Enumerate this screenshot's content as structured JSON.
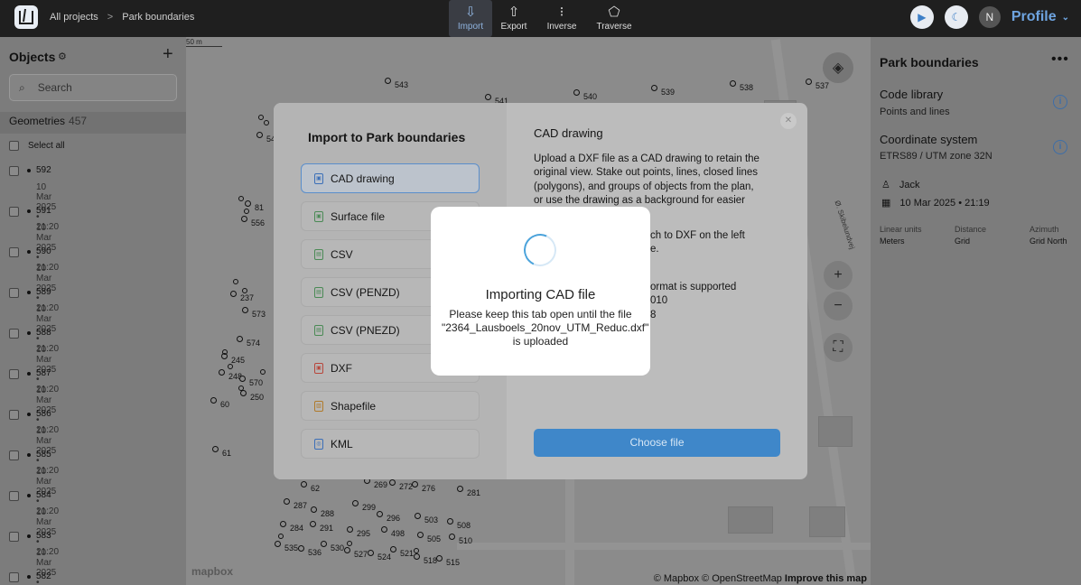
{
  "topbar": {
    "breadcrumb": [
      "All projects",
      "Park boundaries"
    ],
    "breadcrumb_separator": ">",
    "tools": [
      {
        "label": "Import",
        "icon": "import-icon",
        "active": true
      },
      {
        "label": "Export",
        "icon": "export-icon",
        "active": false
      },
      {
        "label": "Inverse",
        "icon": "inverse-icon",
        "active": false
      },
      {
        "label": "Traverse",
        "icon": "traverse-icon",
        "active": false
      }
    ],
    "avatar_initial": "N",
    "profile_label": "Profile"
  },
  "sidebar": {
    "title": "Objects",
    "search_placeholder": "Search",
    "geometries_label": "Geometries",
    "geometries_count": "457",
    "select_all": "Select all",
    "items": [
      {
        "id": "592",
        "date": "10 Mar 2025 • 21:20"
      },
      {
        "id": "591",
        "date": "10 Mar 2025 • 21:20"
      },
      {
        "id": "590",
        "date": "10 Mar 2025 • 21:20"
      },
      {
        "id": "589",
        "date": "10 Mar 2025 • 21:20"
      },
      {
        "id": "588",
        "date": "10 Mar 2025 • 21:20"
      },
      {
        "id": "587",
        "date": "10 Mar 2025 • 21:20"
      },
      {
        "id": "586",
        "date": "10 Mar 2025 • 21:20"
      },
      {
        "id": "585",
        "date": "10 Mar 2025 • 21:20"
      },
      {
        "id": "584",
        "date": "10 Mar 2025 • 21:20"
      },
      {
        "id": "583",
        "date": "10 Mar 2025 • 21:20"
      },
      {
        "id": "582",
        "date": ""
      }
    ]
  },
  "map": {
    "scale_label": "50 m",
    "street_label": "Ø. Skibelundvej",
    "attribution": "© Mapbox © OpenStreetMap",
    "improve": "Improve this map",
    "logo": "mapbox",
    "points": [
      "543",
      "541",
      "540",
      "539",
      "538",
      "537",
      "54",
      "81",
      "556",
      "237",
      "573",
      "574",
      "245",
      "248",
      "570",
      "250",
      "60",
      "61",
      "62",
      "269",
      "272",
      "276",
      "281",
      "287",
      "299",
      "288",
      "296",
      "503",
      "284",
      "291",
      "508",
      "295",
      "498",
      "505",
      "510",
      "535",
      "536",
      "530",
      "527",
      "524",
      "521",
      "518",
      "515"
    ]
  },
  "right_panel": {
    "title": "Park boundaries",
    "code_library_label": "Code library",
    "code_library_value": "Points and lines",
    "coord_system_label": "Coordinate system",
    "coord_system_value": "ETRS89 / UTM zone 32N",
    "user": "Jack",
    "created": "10 Mar 2025 • 21:19",
    "units": [
      {
        "label": "Linear units",
        "value": "Meters"
      },
      {
        "label": "Distance",
        "value": "Grid"
      },
      {
        "label": "Azimuth",
        "value": "Grid North"
      }
    ]
  },
  "dialog": {
    "title": "Import to Park boundaries",
    "options": [
      {
        "label": "CAD drawing",
        "icon": "cad-file-icon",
        "color": "blue",
        "selected": true
      },
      {
        "label": "Surface file",
        "icon": "surface-file-icon",
        "color": "green",
        "selected": false
      },
      {
        "label": "CSV",
        "icon": "csv-file-icon",
        "color": "green",
        "selected": false
      },
      {
        "label": "CSV (PENZD)",
        "icon": "csv-file-icon",
        "color": "green",
        "selected": false
      },
      {
        "label": "CSV (PNEZD)",
        "icon": "csv-file-icon",
        "color": "green",
        "selected": false
      },
      {
        "label": "DXF",
        "icon": "dxf-file-icon",
        "color": "red",
        "selected": false
      },
      {
        "label": "Shapefile",
        "icon": "shapefile-icon",
        "color": "orange",
        "selected": false
      },
      {
        "label": "KML",
        "icon": "kml-file-icon",
        "color": "blue",
        "selected": false
      }
    ],
    "detail_title": "CAD drawing",
    "detail_lines": [
      "Upload a DXF file as a CAD drawing to retain the",
      "original view. Stake out points, lines, closed lines",
      "(polygons), and groups of objects from the plan,",
      "or use the drawing as a background for easier"
    ],
    "detail_partial": [
      "ch to DXF on the left",
      "e.",
      "ormat is supported",
      "010",
      "8"
    ],
    "choose_button": "Choose file"
  },
  "loading": {
    "title": "Importing CAD file",
    "message": "Please keep this tab open until the file \"2364_Lausboels_20nov_UTM_Reduc.dxf\" is uploaded"
  }
}
